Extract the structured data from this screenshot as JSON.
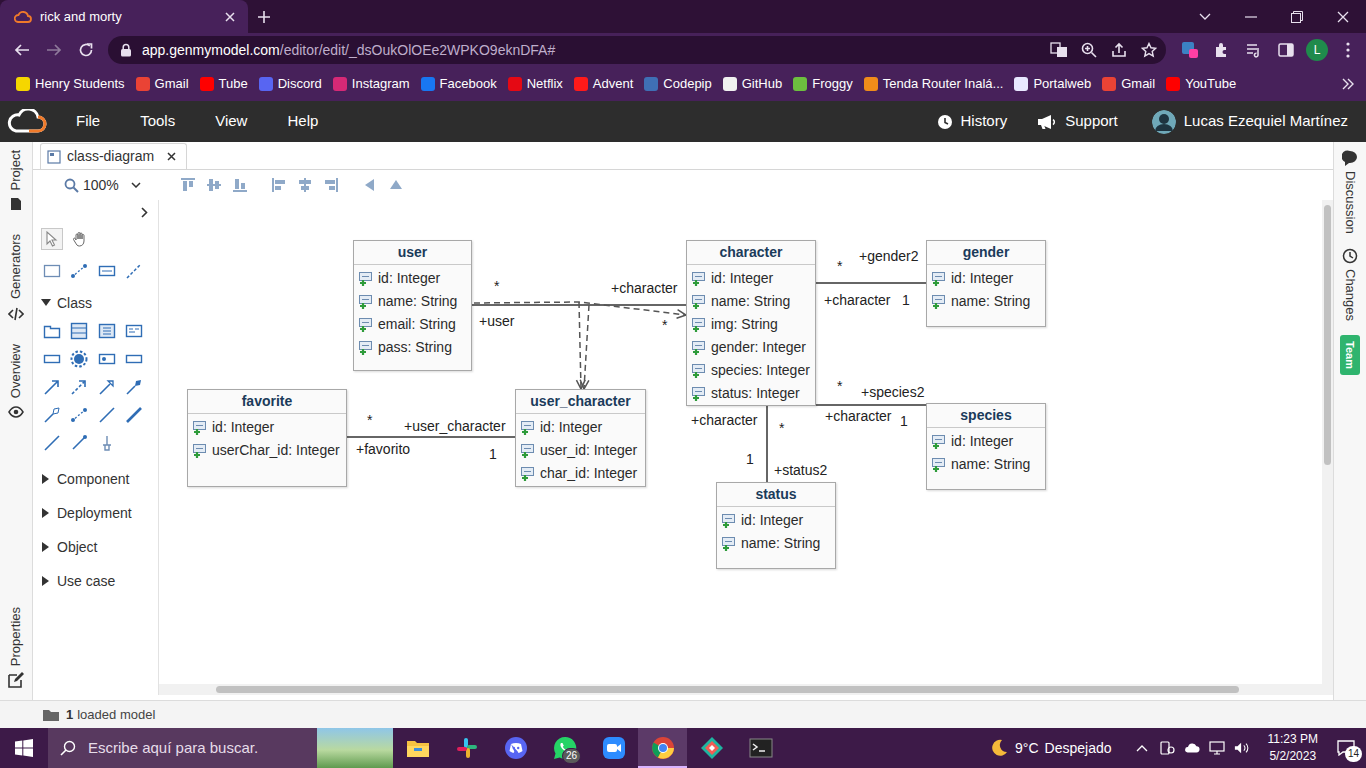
{
  "browser": {
    "tabs": [
      {
        "title": "rick and morty",
        "selected": true
      }
    ],
    "url": {
      "host": "app.genmymodel.com",
      "path": "/editor/edit/_dsOukOlOEe2WPKO9eknDFA#"
    },
    "profile": "L",
    "bookmarks": [
      {
        "label": "Henry Students",
        "color": "#f5d600"
      },
      {
        "label": "Gmail",
        "color": "#ea4335"
      },
      {
        "label": "Tube",
        "color": "#ff0000"
      },
      {
        "label": "Discord",
        "color": "#5865f2"
      },
      {
        "label": "Instagram",
        "color": "#d62976"
      },
      {
        "label": "Facebook",
        "color": "#1877f2"
      },
      {
        "label": "Netflix",
        "color": "#e50914"
      },
      {
        "label": "Advent",
        "color": "#ff1a1a"
      },
      {
        "label": "Codepip",
        "color": "#3f6fb5"
      },
      {
        "label": "GitHub",
        "color": "#f0f0f0"
      },
      {
        "label": "Froggy",
        "color": "#6dbf3f"
      },
      {
        "label": "Tenda Router Inalá...",
        "color": "#f08c1a"
      },
      {
        "label": "Portalweb",
        "color": "#e8e8ff"
      },
      {
        "label": "Gmail",
        "color": "#ea4335"
      },
      {
        "label": "YouTube",
        "color": "#ff0000"
      }
    ]
  },
  "app": {
    "menu": [
      "File",
      "Tools",
      "View",
      "Help"
    ],
    "history": "History",
    "support": "Support",
    "user": "Lucas Ezequiel Martínez"
  },
  "left_rail": [
    {
      "label": "Project"
    },
    {
      "label": "Generators"
    },
    {
      "label": "Overview"
    },
    {
      "label": "Properties"
    }
  ],
  "right_rail": [
    {
      "label": "Discussion",
      "kind": "tab"
    },
    {
      "label": "Changes",
      "kind": "tab"
    },
    {
      "label": "Team",
      "kind": "badge"
    }
  ],
  "editor_tabs": [
    {
      "label": "class-diagram",
      "selected": true
    }
  ],
  "zoom": "100%",
  "palette": {
    "sections": [
      {
        "label": "Class",
        "expanded": true
      },
      {
        "label": "Component",
        "expanded": false
      },
      {
        "label": "Deployment",
        "expanded": false
      },
      {
        "label": "Object",
        "expanded": false
      },
      {
        "label": "Use case",
        "expanded": false
      }
    ]
  },
  "classes": [
    {
      "name": "user",
      "attributes": [
        "id: Integer",
        "name: String",
        "email: String",
        "pass: String"
      ]
    },
    {
      "name": "character",
      "attributes": [
        "id: Integer",
        "name: String",
        "img: String",
        "gender: Integer",
        "species: Integer",
        "status: Integer"
      ]
    },
    {
      "name": "gender",
      "attributes": [
        "id: Integer",
        "name: String"
      ]
    },
    {
      "name": "species",
      "attributes": [
        "id: Integer",
        "name: String"
      ]
    },
    {
      "name": "status",
      "attributes": [
        "id: Integer",
        "name: String"
      ]
    },
    {
      "name": "user_character",
      "attributes": [
        "id: Integer",
        "user_id: Integer",
        "char_id: Integer"
      ]
    },
    {
      "name": "favorite",
      "attributes": [
        "id: Integer",
        "userChar_id: Integer"
      ]
    }
  ],
  "associations": [
    {
      "kind": "association",
      "ends": [
        "*",
        "+user",
        "+character",
        "*"
      ]
    },
    {
      "kind": "dependency",
      "ends": []
    },
    {
      "kind": "dependency",
      "ends": []
    },
    {
      "kind": "dependency",
      "ends": []
    },
    {
      "kind": "association",
      "ends": [
        "*",
        "+gender2",
        "+character",
        "1"
      ]
    },
    {
      "kind": "association",
      "ends": [
        "*",
        "+species2",
        "+character",
        "1"
      ]
    },
    {
      "kind": "association",
      "ends": [
        "+character",
        "*",
        "1",
        "+status2"
      ]
    },
    {
      "kind": "association",
      "ends": [
        "*",
        "+user_character",
        "+favorito",
        "1"
      ]
    }
  ],
  "status_bar": {
    "count": "1",
    "text": "loaded model"
  },
  "taskbar": {
    "search": "Escribe aquí para buscar.",
    "apps": [
      {
        "kind": "explorer",
        "active": false
      },
      {
        "kind": "slack",
        "active": false
      },
      {
        "kind": "discord",
        "active": false
      },
      {
        "kind": "whatsapp",
        "active": false,
        "badge": "26"
      },
      {
        "kind": "zoom",
        "active": false
      },
      {
        "kind": "chrome",
        "active": true
      },
      {
        "kind": "gitkraken",
        "active": false
      },
      {
        "kind": "terminal",
        "active": false
      }
    ],
    "weather": {
      "temp": "9°C",
      "text": "Despejado"
    },
    "clock": {
      "time": "11:23 PM",
      "date": "5/2/2023"
    },
    "notifications": "14"
  }
}
